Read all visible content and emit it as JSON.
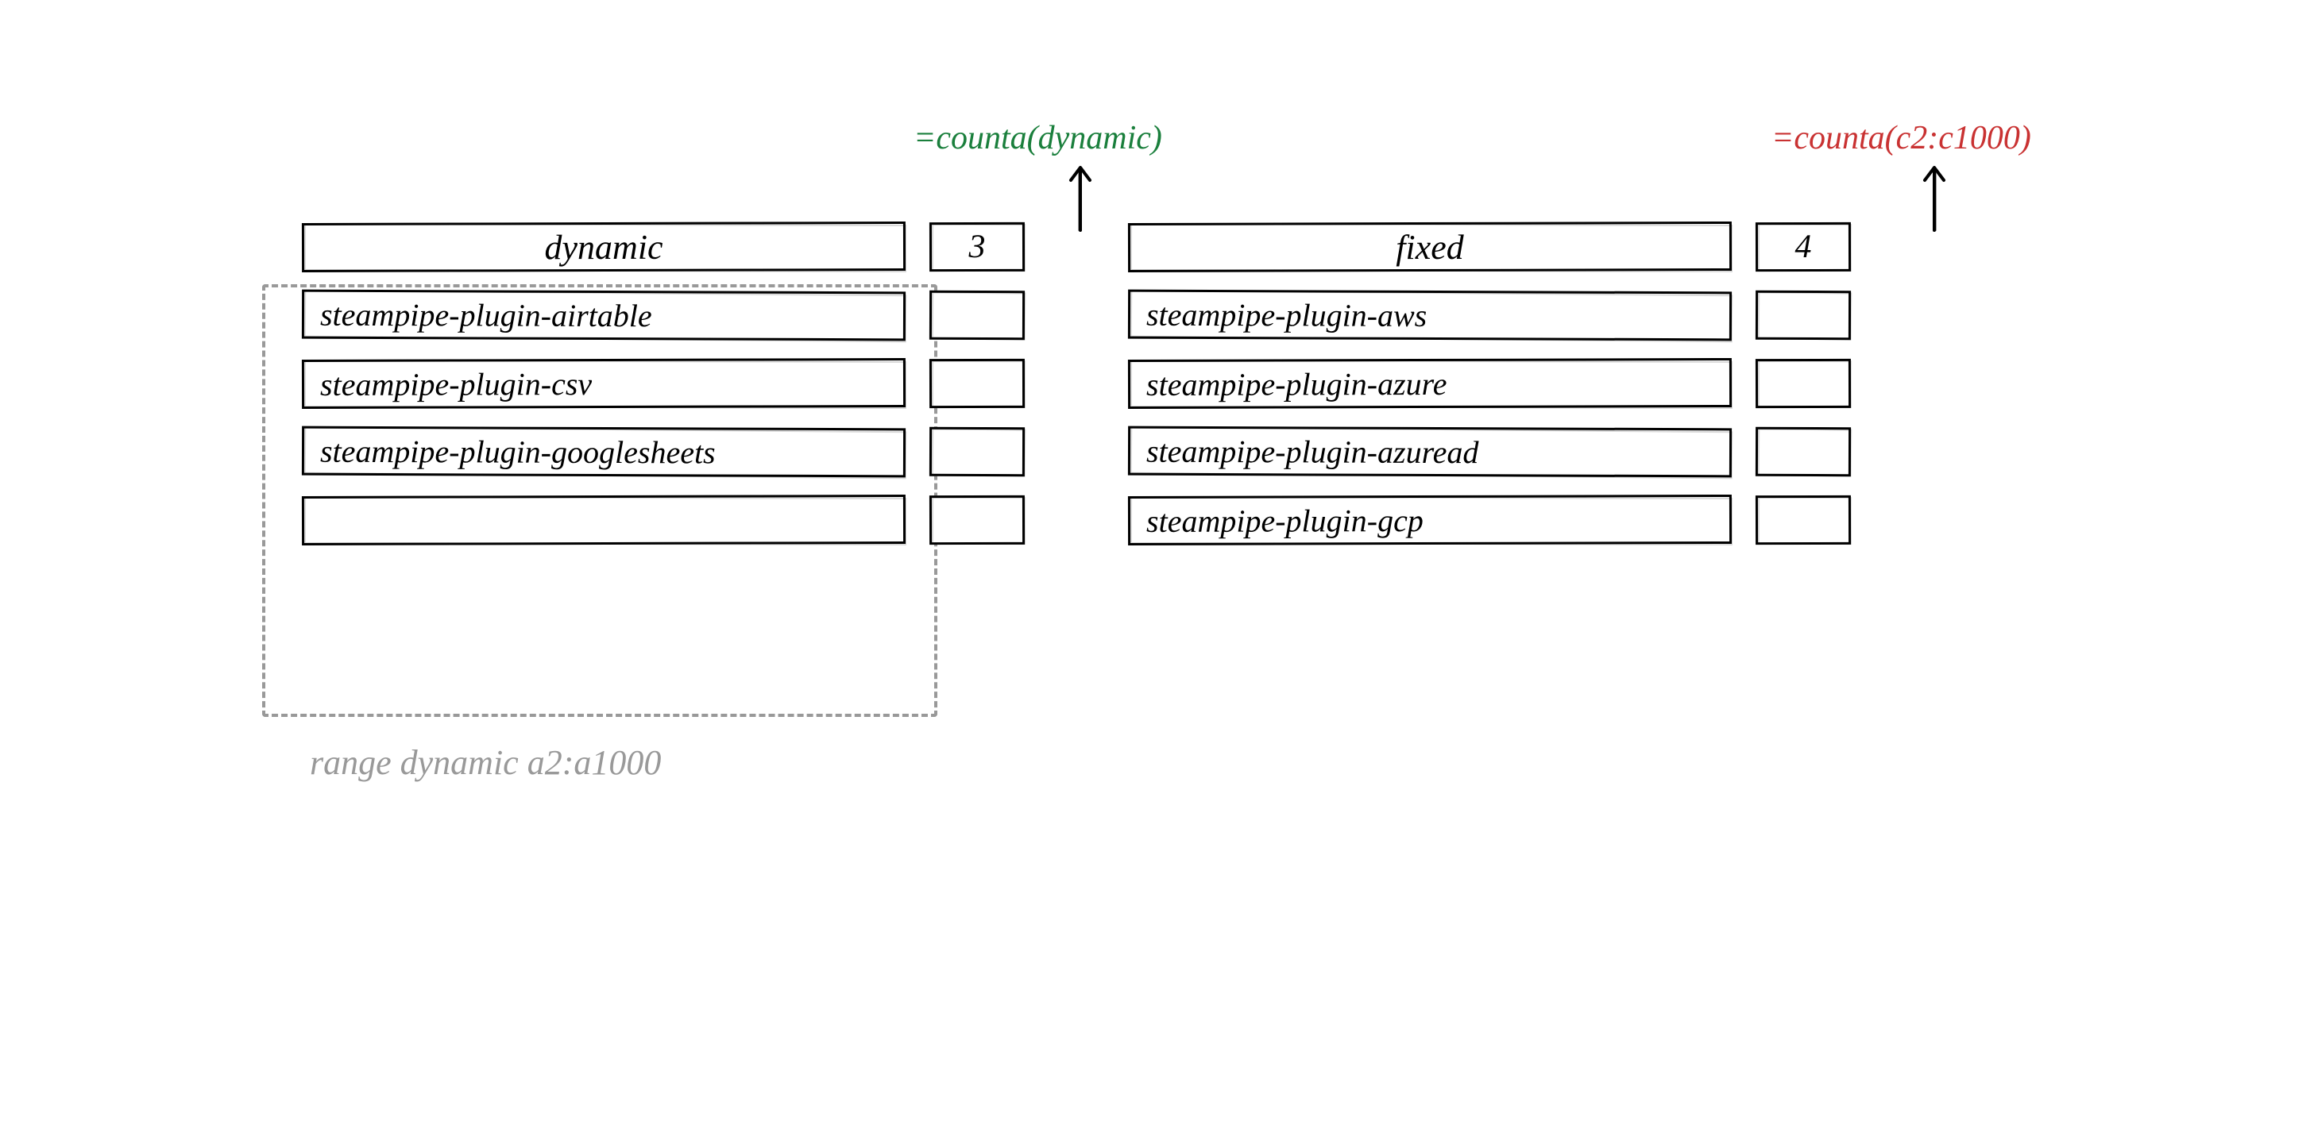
{
  "formulas": {
    "dynamic": "=counta(dynamic)",
    "fixed": "=counta(c2:c1000)"
  },
  "left": {
    "header": "dynamic",
    "count": "3",
    "rows": [
      "steampipe-plugin-airtable",
      "steampipe-plugin-csv",
      "steampipe-plugin-googlesheets",
      ""
    ]
  },
  "right": {
    "header": "fixed",
    "count": "4",
    "rows": [
      "steampipe-plugin-aws",
      "steampipe-plugin-azure",
      "steampipe-plugin-azuread",
      "steampipe-plugin-gcp"
    ]
  },
  "range_label": "range dynamic a2:a1000"
}
